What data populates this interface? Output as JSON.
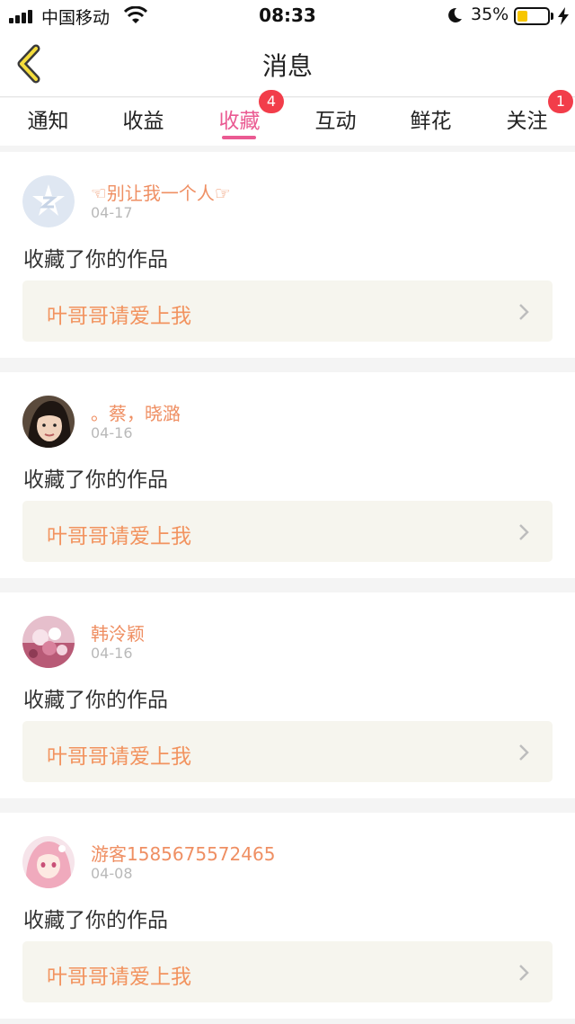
{
  "status_bar": {
    "carrier": "中国移动",
    "time": "08:33",
    "battery_percent": "35%",
    "battery_level": 0.35,
    "icons": [
      "signal-icon",
      "wifi-icon",
      "moon-icon",
      "battery-icon",
      "charging-bolt-icon"
    ]
  },
  "header": {
    "title": "消息",
    "back_icon": "chevron-left-icon"
  },
  "tabs": [
    {
      "label": "通知",
      "active": false,
      "badge": ""
    },
    {
      "label": "收益",
      "active": false,
      "badge": ""
    },
    {
      "label": "收藏",
      "active": true,
      "badge": "4"
    },
    {
      "label": "互动",
      "active": false,
      "badge": ""
    },
    {
      "label": "鲜花",
      "active": false,
      "badge": ""
    },
    {
      "label": "关注",
      "active": false,
      "badge": "1"
    }
  ],
  "colors": {
    "accent": "#ea5a92",
    "badge": "#f23d4a",
    "username": "#ef8f63",
    "work_title": "#f2935f",
    "work_box_bg": "#f6f5ee"
  },
  "items": [
    {
      "user": "☜别让我一个人☞",
      "date": "04-17",
      "action": "收藏了你的作品",
      "work": "叶哥哥请爱上我",
      "avatar": "qq-default-avatar"
    },
    {
      "user": "。蔡，晓潞",
      "date": "04-16",
      "action": "收藏了你的作品",
      "work": "叶哥哥请爱上我",
      "avatar": "photo-avatar"
    },
    {
      "user": "韩泠颖",
      "date": "04-16",
      "action": "收藏了你的作品",
      "work": "叶哥哥请爱上我",
      "avatar": "flower-avatar"
    },
    {
      "user": "游客1585675572465",
      "date": "04-08",
      "action": "收藏了你的作品",
      "work": "叶哥哥请爱上我",
      "avatar": "anime-avatar"
    }
  ]
}
